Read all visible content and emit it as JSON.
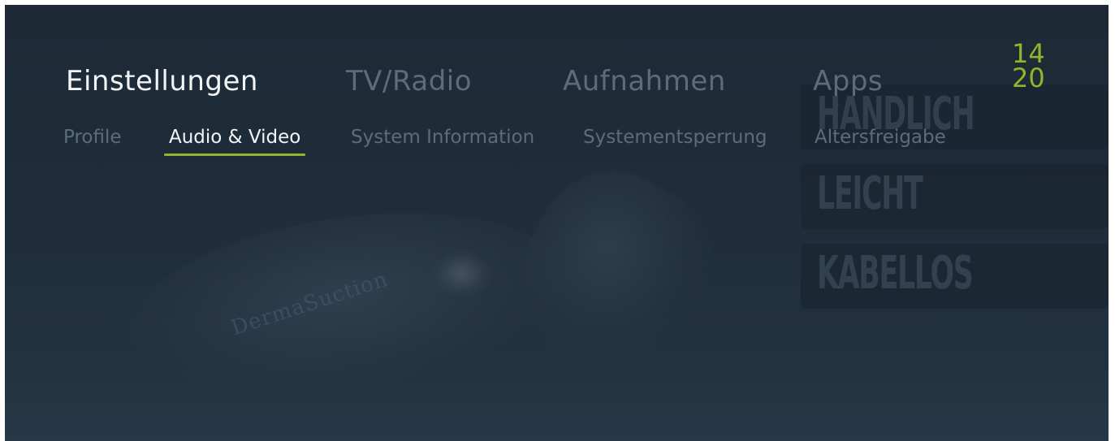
{
  "header": {
    "main_tabs": [
      {
        "label": "Einstellungen",
        "active": true
      },
      {
        "label": "TV/Radio",
        "active": false
      },
      {
        "label": "Aufnahmen",
        "active": false
      },
      {
        "label": "Apps",
        "active": false
      }
    ],
    "clock": {
      "hours": "14",
      "minutes": "20"
    }
  },
  "sub_tabs": [
    {
      "label": "Profile",
      "active": false
    },
    {
      "label": "Audio & Video",
      "active": true
    },
    {
      "label": "System Information",
      "active": false
    },
    {
      "label": "Systementsperrung",
      "active": false
    },
    {
      "label": "Altersfreigabe",
      "active": false
    }
  ],
  "background": {
    "panels": [
      "HANDLICH",
      "LEICHT",
      "KABELLOS"
    ],
    "brand": "DermaSuction"
  },
  "colors": {
    "accent": "#93b52c",
    "active_text": "#f2f4f6",
    "inactive_text": "#5d6c7b",
    "background": "#1f2d3a"
  }
}
